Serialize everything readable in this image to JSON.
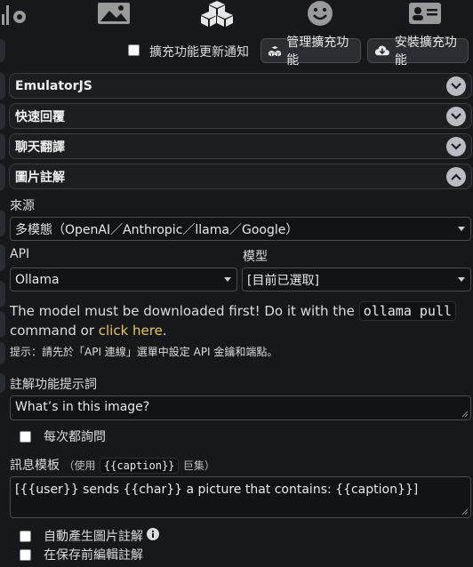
{
  "top_tabs": [
    {
      "icon": "settings-icon"
    },
    {
      "icon": "image-icon"
    },
    {
      "icon": "extensions-cubes-icon"
    },
    {
      "icon": "smiley-icon"
    },
    {
      "icon": "user-card-icon"
    }
  ],
  "toolbar": {
    "notify_label": "擴充功能更新通知",
    "notify_checked": false,
    "manage_label": "管理擴充功能",
    "install_label": "安裝擴充功能"
  },
  "drawers": [
    {
      "title": "EmulatorJS",
      "expanded": false
    },
    {
      "title": "快速回覆",
      "expanded": false
    },
    {
      "title": "聊天翻譯",
      "expanded": false
    },
    {
      "title": "圖片註解",
      "expanded": true
    }
  ],
  "caption": {
    "source_label": "來源",
    "source_value": "多模態（OpenAI／Anthropic／llama／Google）",
    "api_label": "API",
    "api_value": "Ollama",
    "model_label": "模型",
    "model_value": "[目前已選取]",
    "notice_text_1": "The model must be downloaded first! Do it with the ",
    "notice_code": "ollama pull",
    "notice_text_2": "command or ",
    "notice_link": "click here",
    "notice_text_3": ".",
    "hint": "提示：請先於「API 連線」選單中設定 API 金鑰和端點。",
    "prompt_label": "註解功能提示詞",
    "prompt_value": "What’s in this image?",
    "ask_every_time_label": "每次都詢問",
    "template_label": "訊息模板",
    "template_hint_prefix": "（使用",
    "template_hint_code": "{{caption}}",
    "template_hint_suffix": "巨集）",
    "template_value": "[{{user}} sends {{char}} a picture that contains: {{caption}}]",
    "auto_caption_label": "自動產生圖片註解",
    "edit_before_save_label": "在保存前編輯註解"
  }
}
